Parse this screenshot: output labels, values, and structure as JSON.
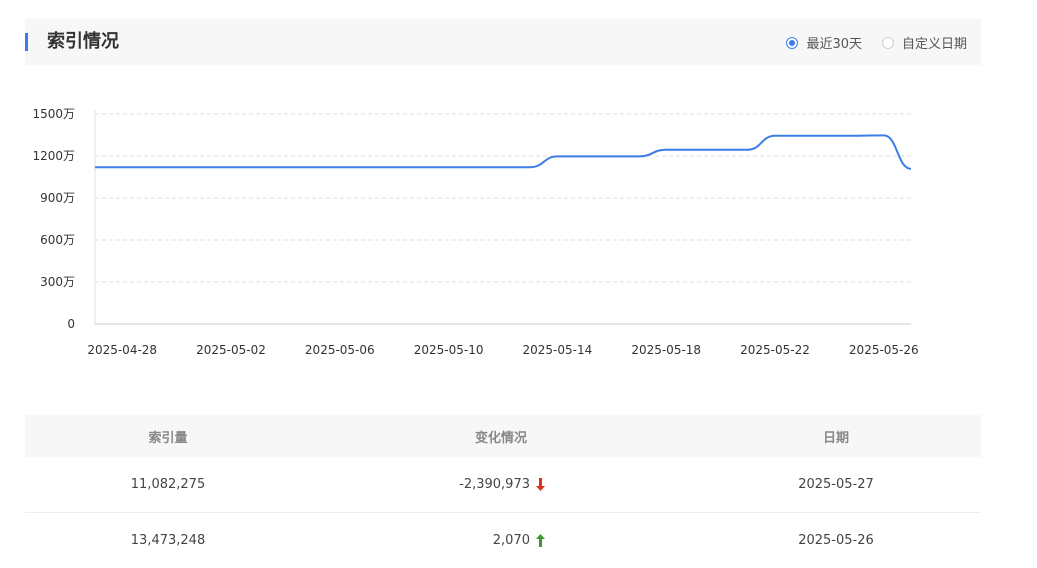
{
  "panel": {
    "title": "索引情况",
    "range_options": [
      {
        "label": "最近30天",
        "checked": true
      },
      {
        "label": "自定义日期",
        "checked": false
      }
    ]
  },
  "chart_data": {
    "type": "line",
    "title": "",
    "xlabel": "",
    "ylabel": "",
    "ylim": [
      0,
      1500
    ],
    "y_ticks": [
      "0",
      "300万",
      "600万",
      "900万",
      "1200万",
      "1500万"
    ],
    "y_tick_values": [
      0,
      300,
      600,
      900,
      1200,
      1500
    ],
    "x_tick_labels": [
      "2025-04-28",
      "2025-05-02",
      "2025-05-06",
      "2025-05-10",
      "2025-05-14",
      "2025-05-18",
      "2025-05-22",
      "2025-05-26"
    ],
    "grid": true,
    "line_color": "#3c7de8",
    "x": [
      "2025-04-27",
      "2025-04-28",
      "2025-04-29",
      "2025-04-30",
      "2025-05-01",
      "2025-05-02",
      "2025-05-03",
      "2025-05-04",
      "2025-05-05",
      "2025-05-06",
      "2025-05-07",
      "2025-05-08",
      "2025-05-09",
      "2025-05-10",
      "2025-05-11",
      "2025-05-12",
      "2025-05-13",
      "2025-05-14",
      "2025-05-15",
      "2025-05-16",
      "2025-05-17",
      "2025-05-18",
      "2025-05-19",
      "2025-05-20",
      "2025-05-21",
      "2025-05-22",
      "2025-05-23",
      "2025-05-24",
      "2025-05-25",
      "2025-05-26",
      "2025-05-27"
    ],
    "values": [
      1120,
      1120,
      1120,
      1120,
      1120,
      1120,
      1120,
      1120,
      1120,
      1120,
      1120,
      1120,
      1120,
      1120,
      1120,
      1120,
      1120,
      1197,
      1197,
      1197,
      1197,
      1245,
      1245,
      1245,
      1245,
      1345,
      1345,
      1345,
      1345,
      1347.3,
      1108.2
    ]
  },
  "table": {
    "headers": [
      "索引量",
      "变化情况",
      "日期"
    ],
    "rows": [
      {
        "index": "11,082,275",
        "change": "-2,390,973",
        "direction": "down",
        "date": "2025-05-27"
      },
      {
        "index": "13,473,248",
        "change": "2,070",
        "direction": "up",
        "date": "2025-05-26"
      }
    ],
    "colors": {
      "down": "#e0321a",
      "up": "#3a9a2f"
    }
  }
}
